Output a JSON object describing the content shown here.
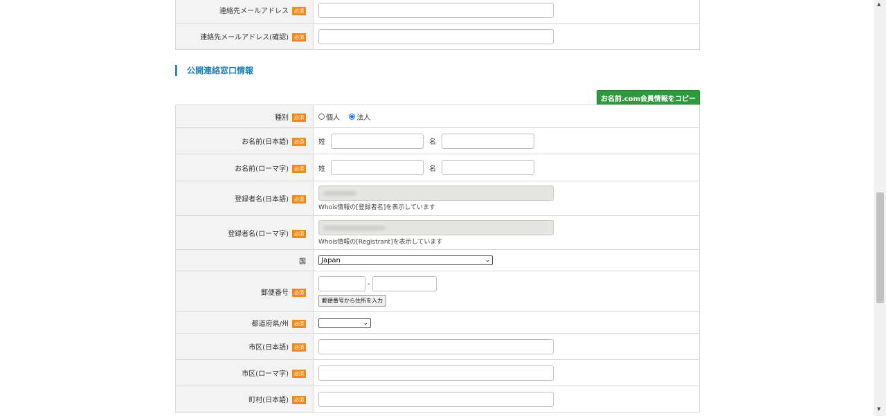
{
  "required_badge": "必須",
  "top_rows": [
    {
      "label": "連絡先メールアドレス"
    },
    {
      "label": "連絡先メールアドレス(確認)"
    }
  ],
  "section": {
    "title": "公開連絡窓口情報",
    "copy_button": "お名前.com会員情報をコピー"
  },
  "type_row": {
    "label": "種別",
    "options": [
      "個人",
      "法人"
    ],
    "selected": "法人"
  },
  "name_ja": {
    "label": "お名前(日本語)",
    "last": "姓",
    "first": "名"
  },
  "name_en": {
    "label": "お名前(ローマ字)",
    "last": "姓",
    "first": "名"
  },
  "registrant_ja": {
    "label": "登録者名(日本語)",
    "note": "Whois情報の[登録者名]を表示しています"
  },
  "registrant_en": {
    "label": "登録者名(ローマ字)",
    "note": "Whois情報の[Registrant]を表示しています"
  },
  "country": {
    "label": "国",
    "value": "Japan"
  },
  "zip": {
    "label": "郵便番号",
    "separator": "-",
    "button": "郵便番号から住所を入力"
  },
  "prefecture": {
    "label": "都道府県/州",
    "value": ""
  },
  "city_ja": {
    "label": "市区(日本語)"
  },
  "city_en": {
    "label": "市区(ローマ字)"
  },
  "town_ja": {
    "label": "町村(日本語)"
  },
  "icons": {
    "dropdown": "chevron-down-icon",
    "scroll_up": "triangle-up-icon",
    "scroll_down": "triangle-down-icon"
  }
}
